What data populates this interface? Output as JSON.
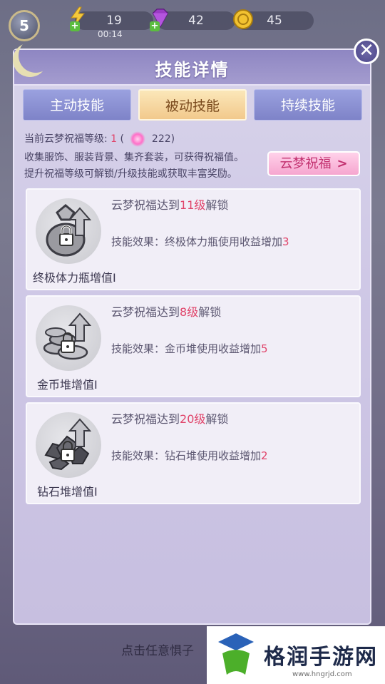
{
  "hud": {
    "level": "5",
    "stamina": "19",
    "stamina_timer": "00:14",
    "gems": "42",
    "coins": "45"
  },
  "panel": {
    "title": "技能详情",
    "close_glyph": "✕",
    "tabs": [
      {
        "label": "主动技能",
        "active": false
      },
      {
        "label": "被动技能",
        "active": true
      },
      {
        "label": "持续技能",
        "active": false
      }
    ],
    "blessing": {
      "level_prefix": "当前云梦祝福等级:",
      "level_value": "1",
      "paren_open": "(",
      "points": "222)",
      "desc1": "收集服饰、服装背景、集齐套装，可获得祝福值。",
      "desc2": "提升祝福等级可解锁/升级技能或获取丰富奖励。",
      "button_label": "云梦祝福",
      "button_icon": "chevron-right"
    },
    "skills": [
      {
        "name": "终极体力瓶增值I",
        "unlock_prefix": "云梦祝福达到",
        "unlock_level": "11级",
        "unlock_suffix": "解锁",
        "effect_prefix": "技能效果：终极体力瓶使用收益增加",
        "effect_value": "3",
        "icon": "locked-potion-icon"
      },
      {
        "name": "金币堆增值I",
        "unlock_prefix": "云梦祝福达到",
        "unlock_level": "8级",
        "unlock_suffix": "解锁",
        "effect_prefix": "技能效果：金币堆使用收益增加",
        "effect_value": "5",
        "icon": "locked-coin-pile-icon"
      },
      {
        "name": "钻石堆增值I",
        "unlock_prefix": "云梦祝福达到",
        "unlock_level": "20级",
        "unlock_suffix": "解锁",
        "effect_prefix": "技能效果：钻石堆使用收益增加",
        "effect_value": "2",
        "icon": "locked-diamond-pile-icon"
      }
    ]
  },
  "bottom": {
    "hint": "点击任意惧子"
  },
  "watermark": {
    "text": "格润手游网",
    "url": "www.hngrjd.com"
  },
  "colors": {
    "accent_red": "#e0446a",
    "tab_active": "#f2c98c",
    "tab_inactive": "#8e93d6"
  }
}
